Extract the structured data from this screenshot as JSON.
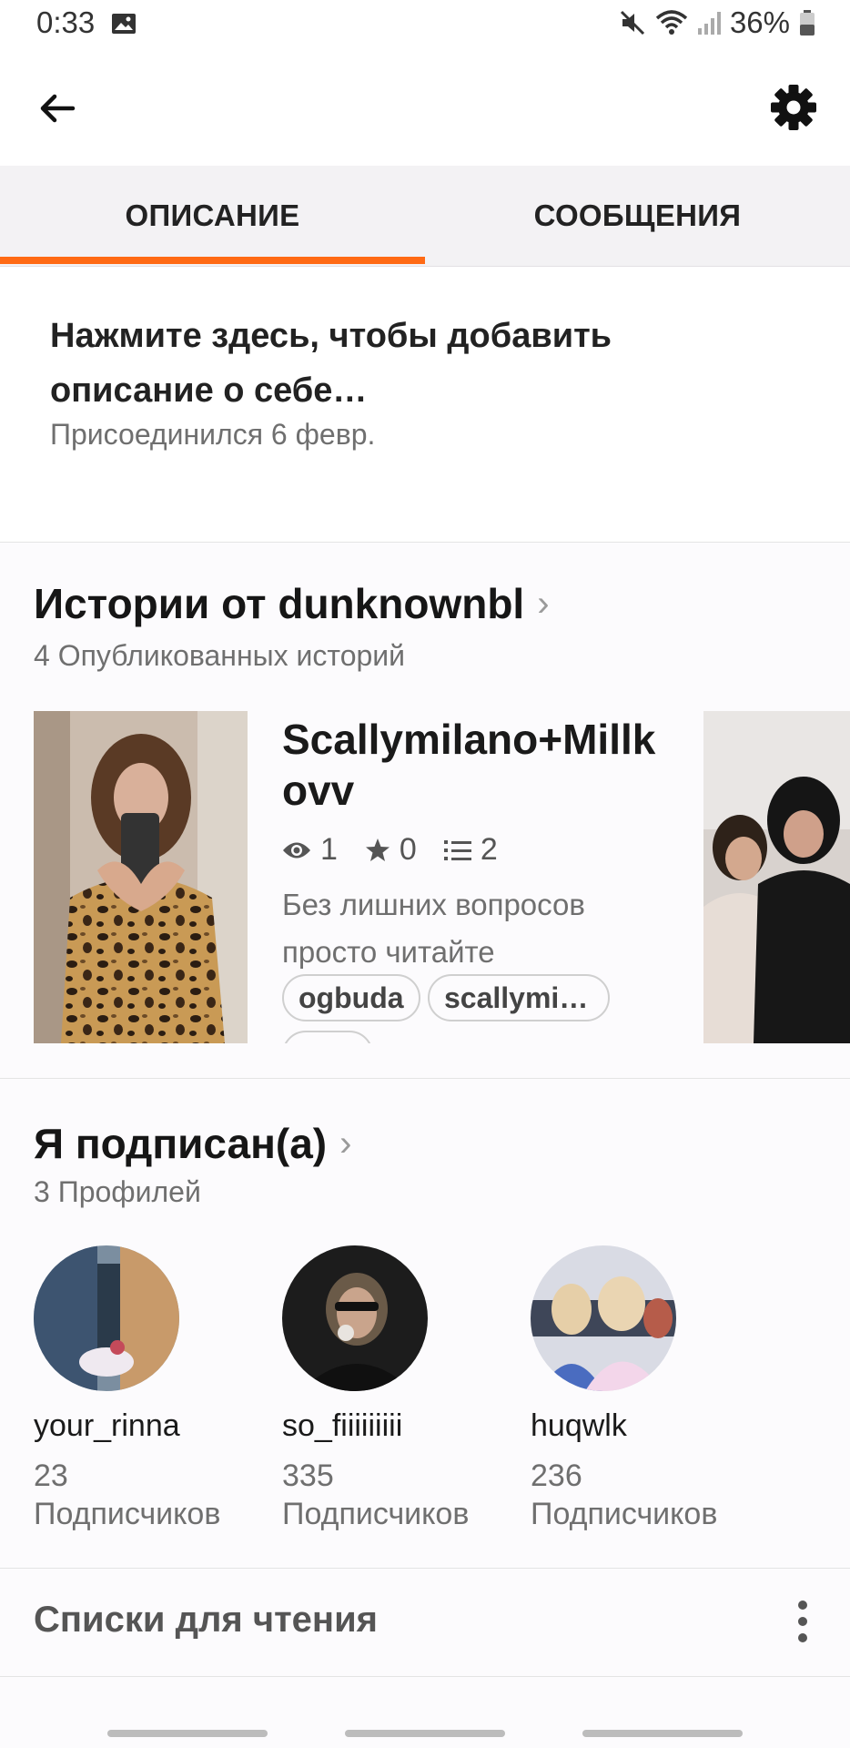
{
  "status_bar": {
    "time": "0:33",
    "battery": "36%",
    "icons": [
      "gallery-icon",
      "mute-icon",
      "wifi-icon",
      "signal-icon",
      "battery-icon"
    ]
  },
  "tabs": [
    {
      "label": "ОПИСАНИЕ",
      "active": true
    },
    {
      "label": "СООБЩЕНИЯ",
      "active": false
    }
  ],
  "description": {
    "prompt": "Нажмите здесь, чтобы добавить описание о себе…",
    "joined": "Присоединился 6 февр."
  },
  "stories": {
    "title": "Истории от dunknownbl",
    "subtitle": "4 Опубликованных историй",
    "items": [
      {
        "title": "Scallymilano+Millkovv",
        "reads": "1",
        "votes": "0",
        "parts": "2",
        "description": "Без лишних вопросов просто читайте",
        "tags": [
          "ogbuda",
          "scallymi…"
        ]
      }
    ]
  },
  "following": {
    "title": "Я подписан(а)",
    "subtitle": "3 Профилей",
    "profiles": [
      {
        "name": "your_rinna",
        "count": "23",
        "label": "Подписчиков"
      },
      {
        "name": "so_fiiiiiiiii",
        "count": "335",
        "label": "Подписчиков"
      },
      {
        "name": "huqwlk",
        "count": "236",
        "label": "Подписчиков"
      }
    ]
  },
  "reading_lists": {
    "label": "Списки для чтения"
  },
  "colors": {
    "accent": "#ff6a14",
    "tab_bg": "#f3f2f4"
  }
}
